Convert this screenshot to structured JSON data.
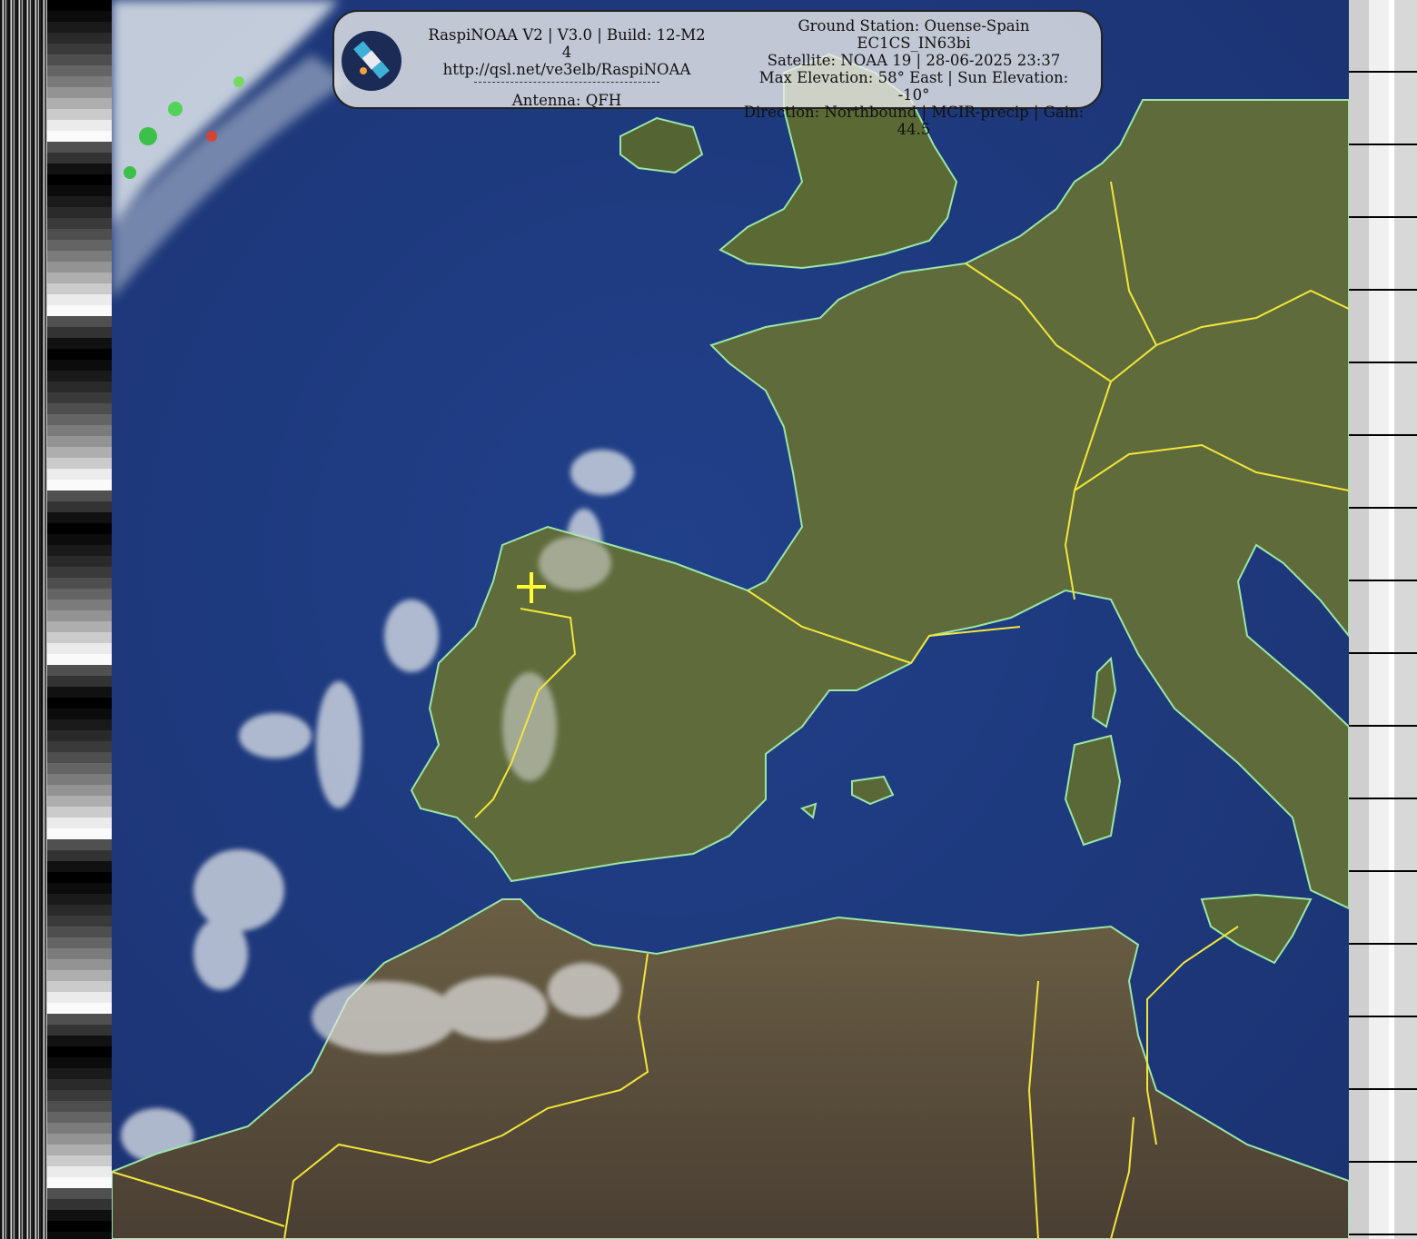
{
  "overlay": {
    "title_line": "RaspiNOAA V2 | V3.0 | Build: 12-M2 4",
    "url_line": "http://qsl.net/ve3elb/RaspiNOAA",
    "antenna_line": "Antenna: QFH",
    "station_line": "Ground Station: Ouense-Spain EC1CS_IN63bi",
    "satellite_line": "Satellite: NOAA 19 | 28-06-2025 23:37",
    "elevation_line": "Max Elevation: 58° East | Sun Elevation: -10°",
    "direction_line": "Direction: Northbound | MCIR-precip | Gain: 44.5"
  },
  "colors": {
    "ocean": "#1f3a7a",
    "land": "#5f6b3b",
    "land_dry": "#6b5a45",
    "coastline": "#9be6a8",
    "borders": "#f2e63a",
    "marker": "#ffff33",
    "cloud": "#e8ecef"
  },
  "icons": {
    "logo": "satellite-icon",
    "marker": "crosshair-marker"
  }
}
